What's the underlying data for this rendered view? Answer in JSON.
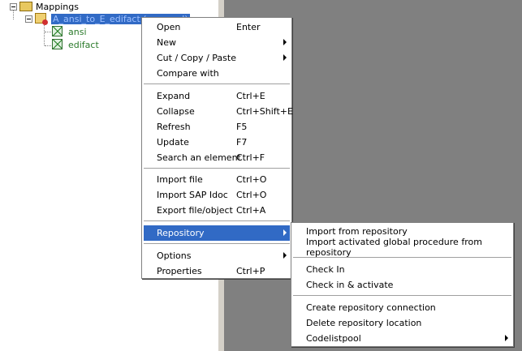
{
  "tree": {
    "root_label": "Mappings",
    "mapping_label": "A_ansi_to_E_edifact (unsaved)",
    "children": [
      {
        "label": "ansi"
      },
      {
        "label": "edifact"
      }
    ]
  },
  "context_menu": {
    "items": [
      {
        "label": "Open",
        "shortcut": "Enter"
      },
      {
        "label": "New",
        "shortcut": ""
      },
      {
        "label": "Cut / Copy / Paste",
        "shortcut": ""
      },
      {
        "label": "Compare with",
        "shortcut": ""
      },
      {
        "label": "Expand",
        "shortcut": "Ctrl+E"
      },
      {
        "label": "Collapse",
        "shortcut": "Ctrl+Shift+E"
      },
      {
        "label": "Refresh",
        "shortcut": "F5"
      },
      {
        "label": "Update",
        "shortcut": "F7"
      },
      {
        "label": "Search an element",
        "shortcut": "Ctrl+F"
      },
      {
        "label": "Import file",
        "shortcut": "Ctrl+O"
      },
      {
        "label": "Import SAP Idoc",
        "shortcut": "Ctrl+O"
      },
      {
        "label": "Export file/object",
        "shortcut": "Ctrl+A"
      },
      {
        "label": "Repository",
        "shortcut": ""
      },
      {
        "label": "Options",
        "shortcut": ""
      },
      {
        "label": "Properties",
        "shortcut": "Ctrl+P"
      }
    ]
  },
  "repository_submenu": {
    "items": [
      {
        "label": "Import from repository"
      },
      {
        "label": "Import activated global procedure from repository"
      },
      {
        "label": "Check In"
      },
      {
        "label": "Check in & activate"
      },
      {
        "label": "Create repository connection"
      },
      {
        "label": "Delete repository location"
      },
      {
        "label": "Codelistpool"
      }
    ]
  },
  "colors": {
    "highlight": "#316ac5",
    "pane_gray": "#808080",
    "tree_green": "#2a7a2a"
  }
}
